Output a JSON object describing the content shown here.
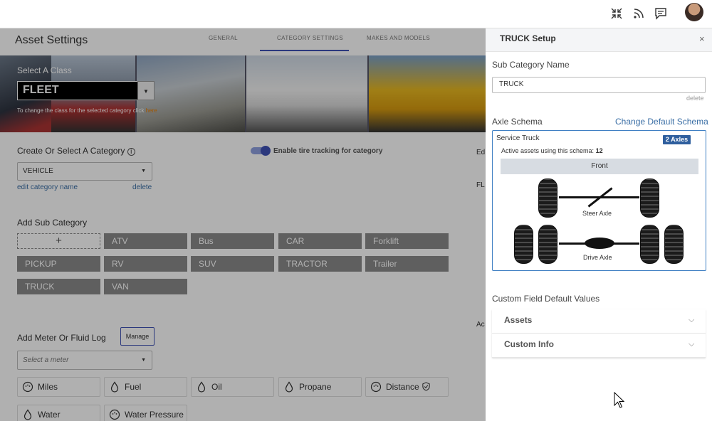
{
  "page": {
    "title": "Asset Settings"
  },
  "tabs": [
    {
      "label": "GENERAL"
    },
    {
      "label": "CATEGORY SETTINGS"
    },
    {
      "label": "MAKES AND MODELS"
    }
  ],
  "topbar": {
    "icons": [
      "collapse-arrows-icon",
      "rss-feed-icon",
      "chat-message-icon",
      "user-avatar"
    ]
  },
  "banner": {
    "label": "Select A Class",
    "selected": "FLEET",
    "help_text": "To change the class for the selected category click",
    "help_link": "here"
  },
  "category": {
    "label": "Create Or Select A Category",
    "selected": "VEHICLE",
    "edit_link": "edit category name",
    "delete_link": "delete",
    "toggle_label": "Enable tire tracking for category",
    "toggle_on": true
  },
  "subcategory": {
    "label": "Add Sub Category",
    "add_symbol": "+",
    "items": [
      "ATV",
      "Bus",
      "CAR",
      "Forklift",
      "PICKUP",
      "RV",
      "SUV",
      "TRACTOR",
      "Trailer",
      "TRUCK",
      "VAN"
    ]
  },
  "meter": {
    "label": "Add Meter Or Fluid Log",
    "manage_label": "Manage",
    "select_placeholder": "Select a meter",
    "items": [
      {
        "label": "Miles",
        "icon": "gauge-icon"
      },
      {
        "label": "Fuel",
        "icon": "drop-icon"
      },
      {
        "label": "Oil",
        "icon": "drop-icon"
      },
      {
        "label": "Propane",
        "icon": "drop-icon"
      },
      {
        "label": "Distance",
        "icon": "gauge-icon"
      },
      {
        "label": "Water",
        "icon": "drop-icon"
      },
      {
        "label": "Water Pressure",
        "icon": "gauge-icon"
      }
    ]
  },
  "peek": {
    "a": "Ed",
    "b": "FL",
    "c": "Ac"
  },
  "panel": {
    "title": "TRUCK Setup",
    "close": "×",
    "subcat_label": "Sub Category Name",
    "subcat_value": "TRUCK",
    "delete_label": "delete",
    "axle_label": "Axle Schema",
    "change_link": "Change Default Schema",
    "schema": {
      "name": "Service Truck",
      "badge": "2 Axles",
      "active_text": "Active assets using this schema:",
      "active_count": "12",
      "front_label": "Front",
      "steer_label": "Steer Axle",
      "drive_label": "Drive Axle"
    },
    "custom_label": "Custom Field Default Values",
    "accordions": [
      {
        "label": "Assets"
      },
      {
        "label": "Custom Info"
      }
    ]
  },
  "colors": {
    "accent": "#3f51b5",
    "badge": "#2f5f9e",
    "link": "#3a6ea5",
    "chip": "#8a8a8a"
  }
}
